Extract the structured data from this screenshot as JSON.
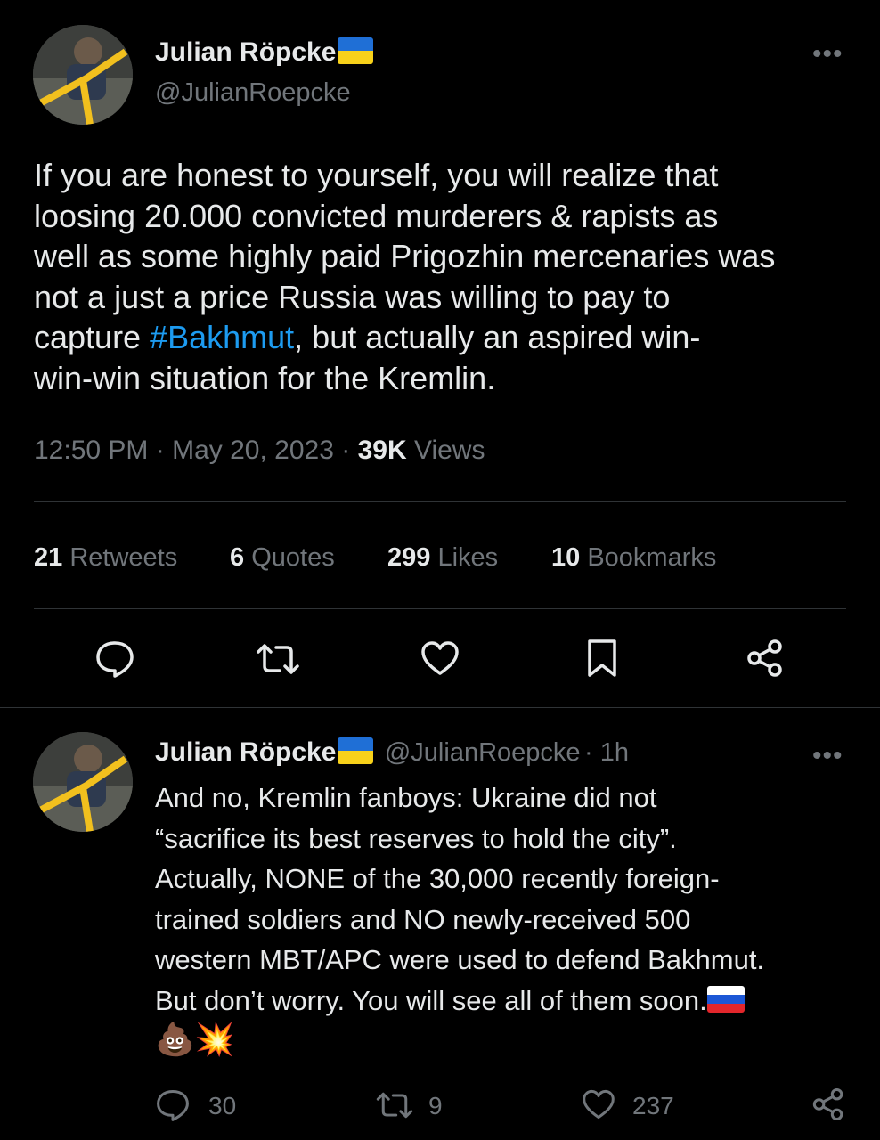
{
  "tweet": {
    "author_name": "Julian Röpcke",
    "author_handle": "@JulianRoepcke",
    "more_label": "•••",
    "text_before": "If you are honest to yourself, you will realize that\nloosing 20.000 convicted murderers & rapists as\nwell as some highly paid Prigozhin mercenaries was\nnot a just a price Russia was willing to pay to\ncapture ",
    "hashtag": "#Bakhmut",
    "text_after": ", but actually an aspired win-\nwin-win situation for the Kremlin.",
    "time": "12:50 PM",
    "date": "May 20, 2023",
    "views_count": "39K",
    "views_label": "Views",
    "sep": "·",
    "stats": {
      "retweets_count": "21",
      "retweets_label": "Retweets",
      "quotes_count": "6",
      "quotes_label": "Quotes",
      "likes_count": "299",
      "likes_label": "Likes",
      "bookmarks_count": "10",
      "bookmarks_label": "Bookmarks"
    }
  },
  "reply": {
    "author_name": "Julian Röpcke",
    "author_handle": "@JulianRoepcke",
    "age": "· 1h",
    "more_label": "•••",
    "text": "And no, Kremlin fanboys: Ukraine did not\n“sacrifice its best reserves to hold the city”.\nActually, NONE of the 30,000 recently foreign-\ntrained soldiers and NO newly-received 500\nwestern MBT/APC were used to defend Bakhmut.\nBut don’t worry. You will see all of them soon.",
    "emojis": "💩💥",
    "reply_count": "30",
    "retweet_count": "9",
    "like_count": "237"
  },
  "colors": {
    "background": "#000000",
    "text": "#e7e9ea",
    "muted": "#71767b",
    "link": "#1d9bf0",
    "divider": "#2f3336"
  }
}
